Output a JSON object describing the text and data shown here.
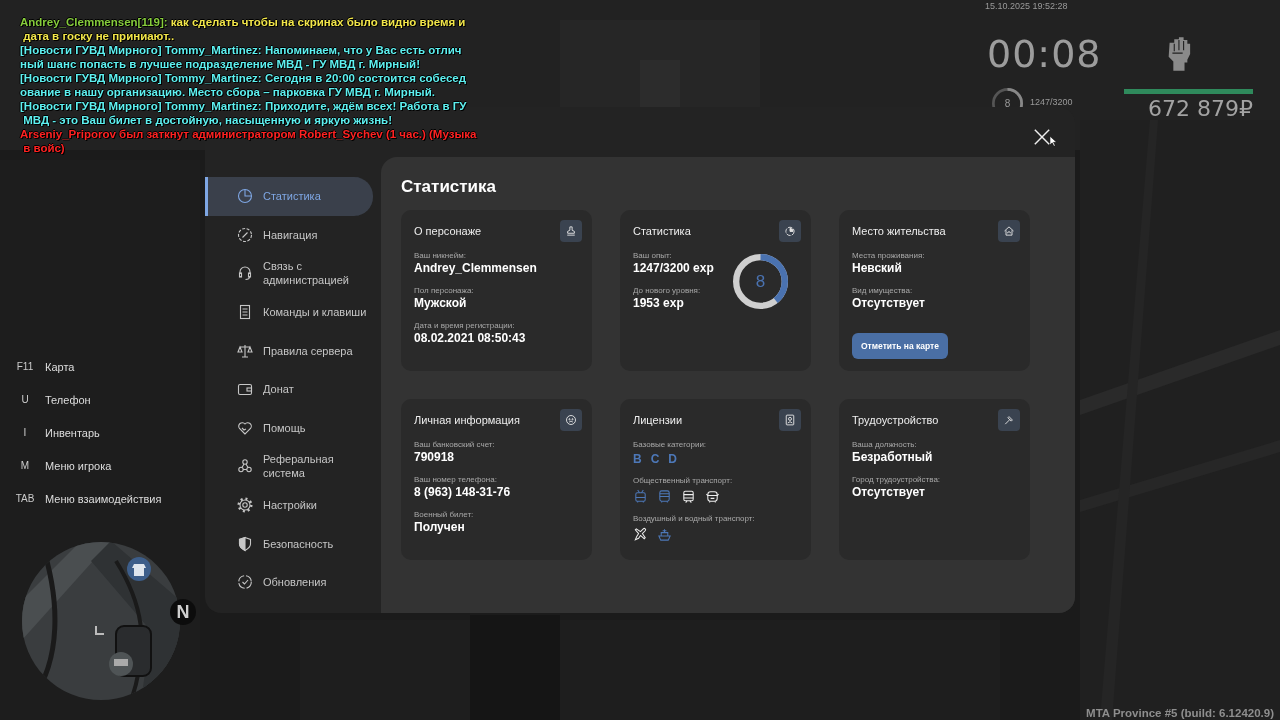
{
  "hud": {
    "datetime": "15.10.2025 19:52:28",
    "timer": "00:08",
    "level_ring": {
      "value": "8"
    },
    "experience": "1247/3200",
    "health": {
      "level": 1
    },
    "money": "672 879₽"
  },
  "chat": [
    {
      "color": "#f2e64a",
      "prefix": {
        "text": "Andrey_Clemmensen[119]:",
        "color": "#86cc3c"
      },
      "lines": [
        " как сделать чтобы на скринах было видно время и",
        " дата в госку не приниают.."
      ]
    },
    {
      "color": "#5ef0f0",
      "lines": [
        "[Новости ГУВД Мирного] Tommy_Martinez: Напоминаем, что у Вас есть отлич",
        "ный шанс попасть в лучшее подразделение МВД - ГУ МВД г. Мирный!"
      ]
    },
    {
      "color": "#5ef0f0",
      "lines": [
        "[Новости ГУВД Мирного] Tommy_Martinez: Сегодня в 20:00 состоится собесед",
        "ование в нашу организацию. Место сбора – парковка ГУ МВД г. Мирный."
      ]
    },
    {
      "color": "#5ef0f0",
      "lines": [
        "[Новости ГУВД Мирного] Tommy_Martinez: Приходите, ждём всех! Работа в ГУ",
        " МВД - это Ваш билет в достойную, насыщенную и яркую жизнь!"
      ]
    },
    {
      "color": "#ff2222",
      "lines": [
        "Arseniy_Priporov был заткнут администратором Robert_Sychev (1 час.) (Музыка",
        " в войс)"
      ]
    }
  ],
  "hotkeys": [
    {
      "key": "F11",
      "label": "Карта"
    },
    {
      "key": "U",
      "label": "Телефон"
    },
    {
      "key": "I",
      "label": "Инвентарь"
    },
    {
      "key": "M",
      "label": "Меню игрока"
    },
    {
      "key": "TAB",
      "label": "Меню взаимодействия"
    }
  ],
  "minimap": {
    "compass": "N"
  },
  "menu": {
    "sidebar": {
      "items": [
        {
          "label": "Статистика",
          "selected": true
        },
        {
          "label": "Навигация",
          "selected": false
        },
        {
          "label": "Связь с администрацией",
          "selected": false
        },
        {
          "label": "Команды и клавиши",
          "selected": false
        },
        {
          "label": "Правила сервера",
          "selected": false
        },
        {
          "label": "Донат",
          "selected": false
        },
        {
          "label": "Помощь",
          "selected": false
        },
        {
          "label": "Реферальная система",
          "selected": false
        },
        {
          "label": "Настройки",
          "selected": false
        },
        {
          "label": "Безопасность",
          "selected": false
        },
        {
          "label": "Обновления",
          "selected": false
        }
      ]
    },
    "content": {
      "title": "Статистика",
      "cards": [
        {
          "title": "О персонаже",
          "fields": [
            {
              "kind": "text",
              "label": "Ваш никнейм:",
              "value": "Andrey_Clemmensen"
            },
            {
              "kind": "text",
              "label": "Пол персонажа:",
              "value": "Мужской"
            },
            {
              "kind": "text",
              "label": "Дата и время регистрации:",
              "value": "08.02.2021 08:50:43"
            }
          ]
        },
        {
          "title": "Статистика",
          "ring": {
            "value": "8"
          },
          "fields": [
            {
              "kind": "text",
              "label": "Ваш опыт:",
              "value": "1247/3200 exp"
            },
            {
              "kind": "text",
              "label": "До нового уровня:",
              "value": "1953 exp"
            }
          ]
        },
        {
          "title": "Место жительства",
          "button": "Отметить на карте",
          "fields": [
            {
              "kind": "text",
              "label": "Места проживания:",
              "value": "Невский"
            },
            {
              "kind": "text",
              "label": "Вид имущества:",
              "value": "Отсутствует"
            }
          ]
        },
        {
          "title": "Личная информация",
          "fields": [
            {
              "kind": "text",
              "label": "Ваш банковский счет:",
              "value": "790918"
            },
            {
              "kind": "text",
              "label": "Ваш номер телефона:",
              "value": "8 (963) 148-31-76"
            },
            {
              "kind": "text",
              "label": "Военный билет:",
              "value": "Получен"
            }
          ]
        },
        {
          "title": "Лицензии",
          "fields": [
            {
              "kind": "categories",
              "label": "Базовые категории:",
              "items": [
                {
                  "text": "B",
                  "held": true
                },
                {
                  "text": "C",
                  "held": true
                },
                {
                  "text": "D",
                  "held": true
                }
              ]
            },
            {
              "kind": "vehicles",
              "label": "Общественный транспорт:",
              "items": [
                {
                  "kind": "trolleybus",
                  "held": true
                },
                {
                  "kind": "bus",
                  "held": true
                },
                {
                  "kind": "tram",
                  "held": false
                },
                {
                  "kind": "coach",
                  "held": false
                }
              ]
            },
            {
              "kind": "vehicles",
              "label": "Воздушный и водный транспорт:",
              "items": [
                {
                  "kind": "plane",
                  "held": false
                },
                {
                  "kind": "boat",
                  "held": true
                }
              ]
            }
          ]
        },
        {
          "title": "Трудоустройство",
          "fields": [
            {
              "kind": "text",
              "label": "Ваша должность:",
              "value": "Безработный"
            },
            {
              "kind": "text",
              "label": "Город трудоустройства:",
              "value": "Отсутствует"
            }
          ]
        }
      ]
    }
  },
  "build_info": "MTA Province #5 (build: 6.12420.9)"
}
